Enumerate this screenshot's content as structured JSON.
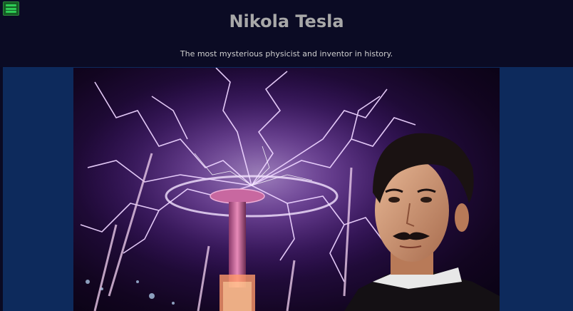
{
  "header": {
    "title": "Nikola Tesla",
    "subtitle": "The most mysterious physicist and inventor in history."
  },
  "menu": {
    "icon": "hamburger-menu-icon",
    "color": "#2ecc55"
  },
  "hero": {
    "image_description_icon": "tesla-portrait-with-lightning-coil"
  },
  "colors": {
    "page_background": "#0a0a22",
    "content_background": "#0d2a5c",
    "title_color": "#a8a8a8",
    "lightning": "#e8c8ff"
  }
}
